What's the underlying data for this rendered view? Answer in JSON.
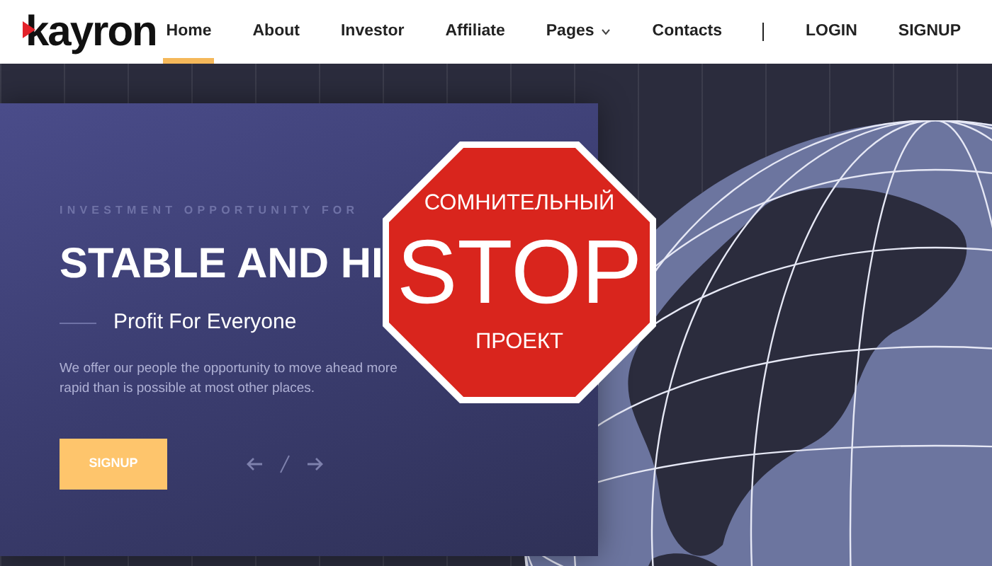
{
  "logo": {
    "text": "kayron"
  },
  "nav": [
    {
      "label": "Home",
      "selected": true,
      "kind": "link"
    },
    {
      "label": "About",
      "selected": false,
      "kind": "link"
    },
    {
      "label": "Investor",
      "selected": false,
      "kind": "link"
    },
    {
      "label": "Affiliate",
      "selected": false,
      "kind": "link"
    },
    {
      "label": "Pages",
      "selected": false,
      "kind": "dropdown"
    },
    {
      "label": "Contacts",
      "selected": false,
      "kind": "link"
    }
  ],
  "auth": [
    "LOGIN",
    "SIGNUP"
  ],
  "hero": {
    "eyebrow": "INVESTMENT OPPORTUNITY FOR",
    "title": "STABLE AND HI",
    "subtitle": "Profit For Everyone",
    "text": "We offer our people the opportunity to move ahead more rapid than is possible at most other places.",
    "button": "SIGNUP"
  },
  "stop_sign": {
    "top": "СОМНИТЕЛЬНЫЙ",
    "main": "STOP",
    "bottom": "ПРОЕКТ"
  }
}
